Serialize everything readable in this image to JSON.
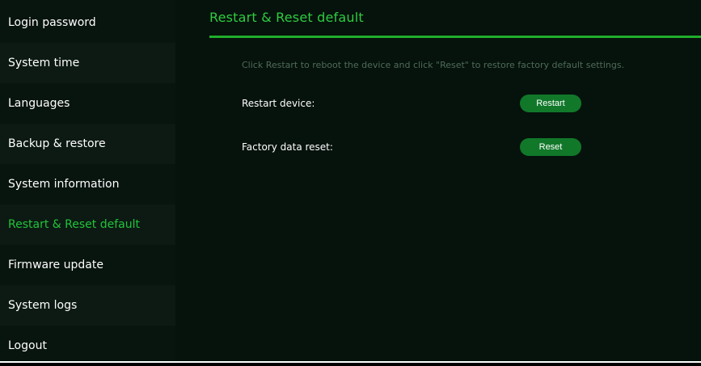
{
  "sidebar": {
    "items": [
      {
        "label": "Login password"
      },
      {
        "label": "System time"
      },
      {
        "label": "Languages"
      },
      {
        "label": "Backup & restore"
      },
      {
        "label": "System information"
      },
      {
        "label": "Restart & Reset default"
      },
      {
        "label": "Firmware update"
      },
      {
        "label": "System logs"
      },
      {
        "label": "Logout"
      }
    ],
    "active": "Restart & Reset default"
  },
  "main": {
    "title": "Restart & Reset default",
    "description": "Click Restart to reboot the device and click \"Reset\" to restore factory default settings.",
    "rows": [
      {
        "label": "Restart device:",
        "button": "Restart"
      },
      {
        "label": "Factory data reset:",
        "button": "Reset"
      }
    ]
  },
  "colors": {
    "accent": "#2ecc40",
    "button": "#11782a",
    "sidebar_bg": "#08140e",
    "main_bg": "#06120c"
  }
}
